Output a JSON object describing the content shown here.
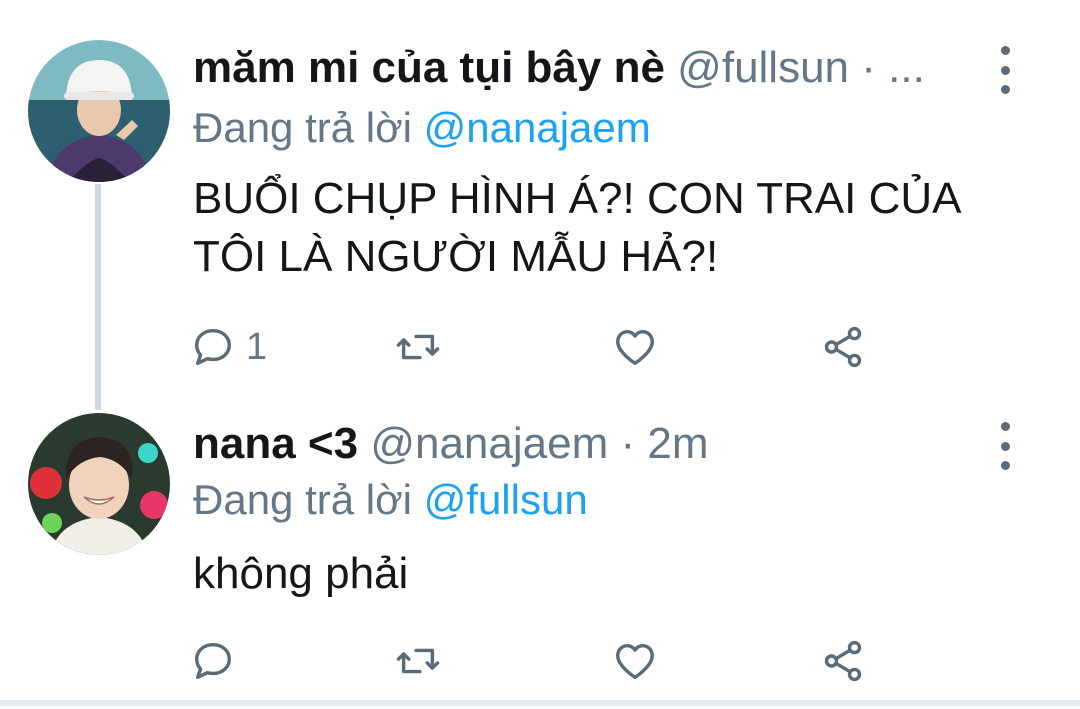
{
  "tweets": [
    {
      "display_name": "măm mi của tụi bây nè",
      "handle": "@fullsun",
      "separator": "·",
      "time": "...",
      "replying_prefix": "Đang trả lời",
      "replying_to": "@nanajaem",
      "text": "BUỔI CHỤP HÌNH Á?! CON TRAI CỦA TÔI LÀ NGƯỜI MẪU HẢ?!",
      "reply_count": "1",
      "icons": [
        "reply-icon",
        "retweet-icon",
        "like-icon",
        "share-icon",
        "more-icon"
      ]
    },
    {
      "display_name": "nana <3",
      "handle": "@nanajaem",
      "separator": "·",
      "time": "2m",
      "replying_prefix": "Đang trả lời",
      "replying_to": "@fullsun",
      "text": "không phải",
      "reply_count": "",
      "icons": [
        "reply-icon",
        "retweet-icon",
        "like-icon",
        "share-icon",
        "more-icon"
      ]
    }
  ],
  "colors": {
    "text_primary": "#14171a",
    "text_secondary": "#657786",
    "mention": "#1da1f2",
    "thread_line": "#cfd9de",
    "icon": "#5b6b78"
  }
}
